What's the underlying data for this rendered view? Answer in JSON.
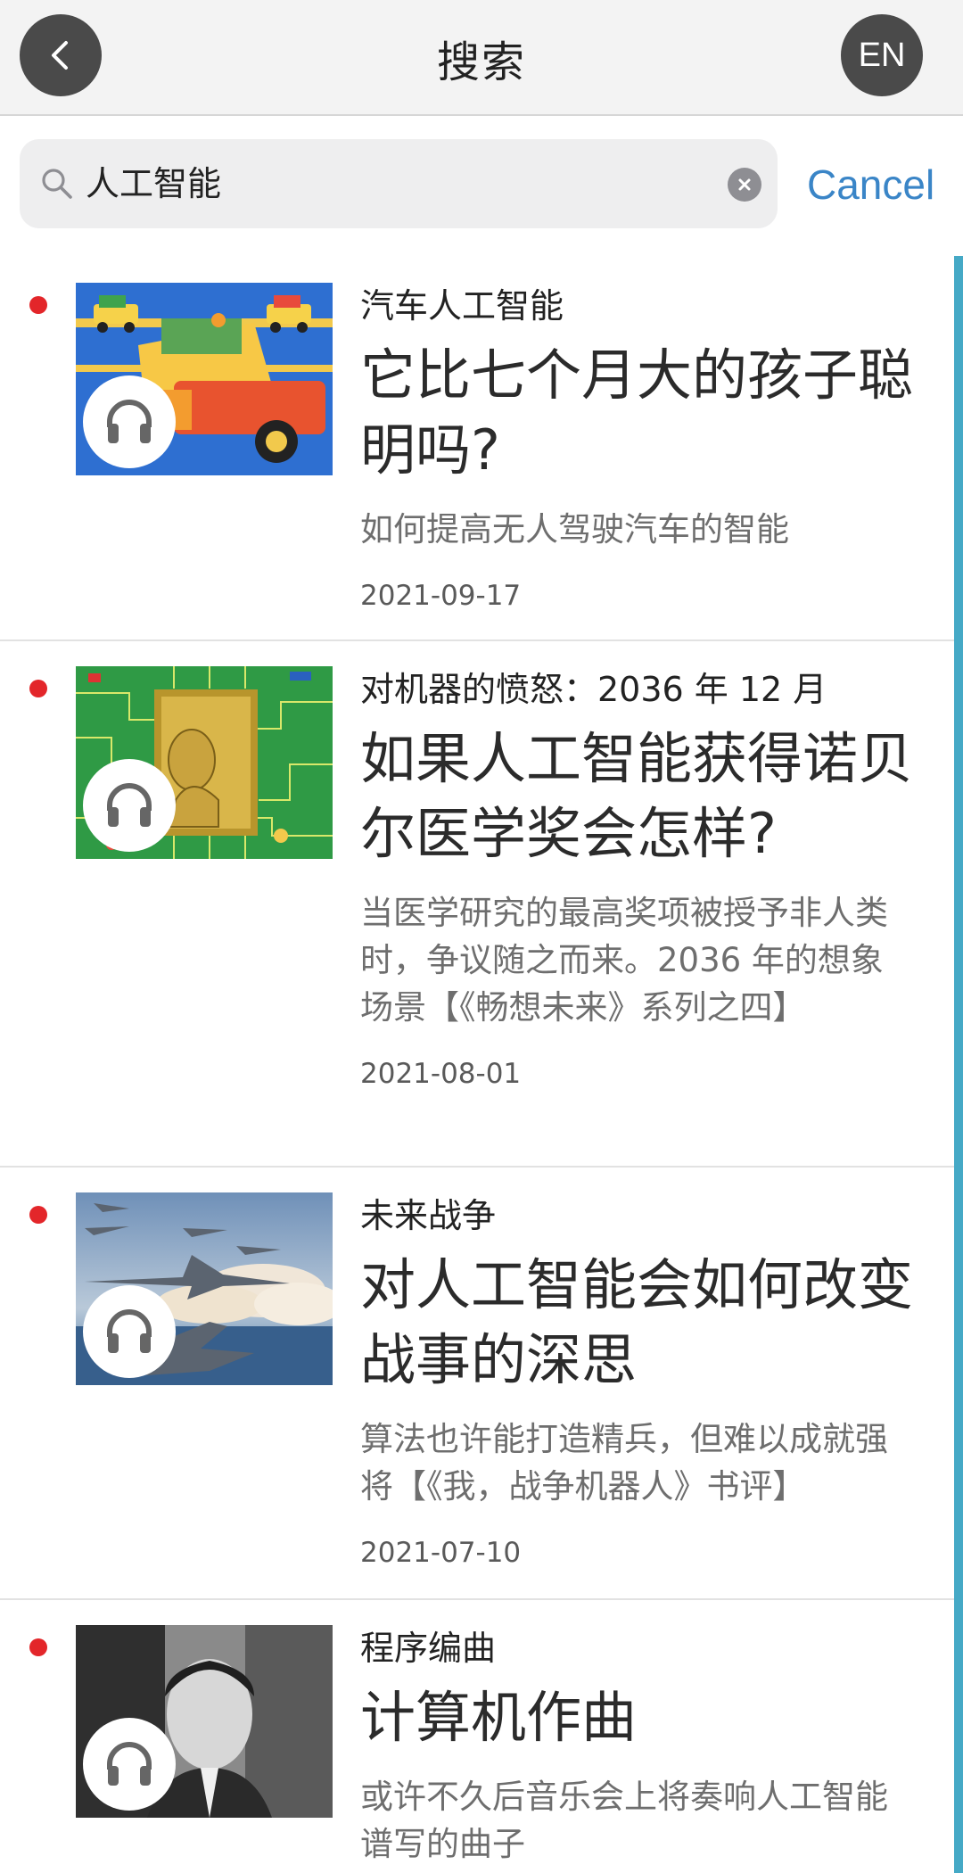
{
  "header": {
    "title": "搜索",
    "lang_button": "EN"
  },
  "search": {
    "query": "人工智能",
    "cancel_label": "Cancel"
  },
  "articles": [
    {
      "kicker": "汽车人工智能",
      "title": "它比七个月大的孩子聪明吗?",
      "summary": "如何提高无人驾驶汽车的智能",
      "date": "2021-09-17",
      "image": "cartoon-car-illustration",
      "unread": true,
      "has_audio": true
    },
    {
      "kicker": "对机器的愤怒：2036 年 12 月",
      "title": "如果人工智能获得诺贝尔医学奖会怎样?",
      "summary": "当医学研究的最高奖项被授予非人类时，争议随之而来。2036 年的想象场景【《畅想未来》系列之四】",
      "date": "2021-08-01",
      "image": "nobel-medal-circuit-board",
      "unread": true,
      "has_audio": true
    },
    {
      "kicker": "未来战争",
      "title": "对人工智能会如何改变战事的深思",
      "summary": "算法也许能打造精兵，但难以成就强将【《我，战争机器人》书评】",
      "date": "2021-07-10",
      "image": "fighter-jets-sky",
      "unread": true,
      "has_audio": true
    },
    {
      "kicker": "程序编曲",
      "title": "计算机作曲",
      "summary": "或许不久后音乐会上将奏响人工智能谱写的曲子",
      "date": "",
      "image": "pianist-portrait",
      "unread": true,
      "has_audio": true
    }
  ],
  "colors": {
    "accent": "#3a85c7",
    "unread_dot": "#e3262a",
    "scroll_indicator": "#45a9c6",
    "header_bg": "#f3f3f3"
  },
  "icons": [
    "chevron-left-icon",
    "search-icon",
    "clear-icon",
    "headphones-icon"
  ]
}
